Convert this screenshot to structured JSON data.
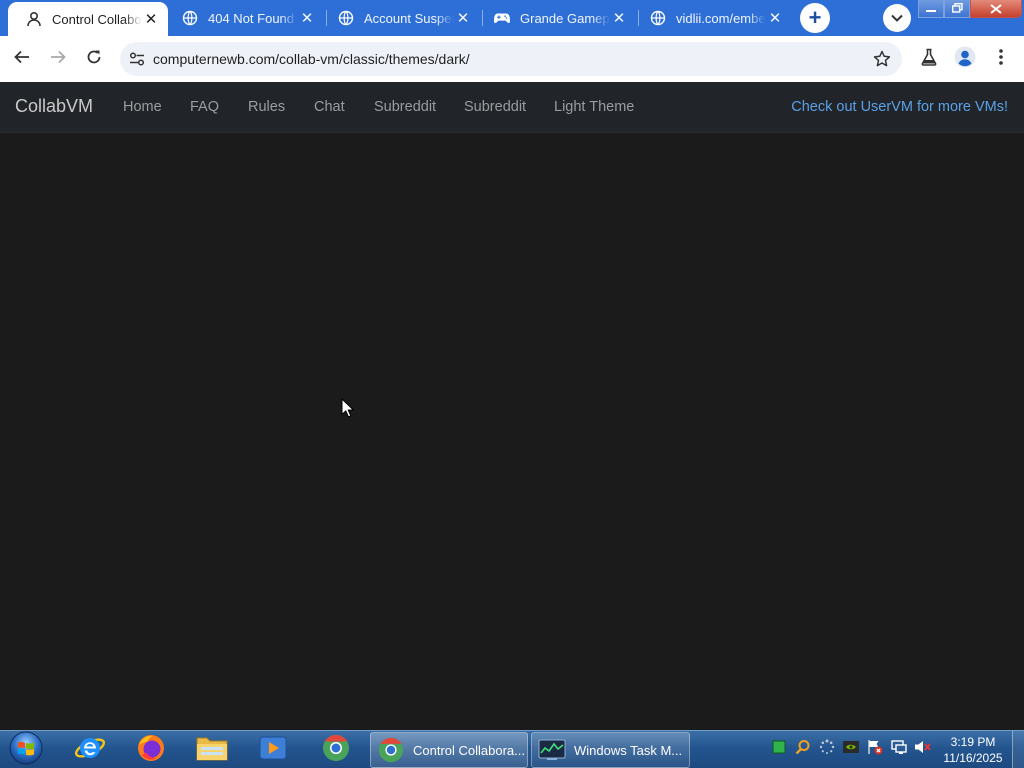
{
  "browser": {
    "tabs": [
      {
        "title": "Control Collaborative Virtual Machines!",
        "active": true,
        "icon": "collabvm-icon"
      },
      {
        "title": "404 Not Found",
        "active": false,
        "icon": "globe-icon"
      },
      {
        "title": "Account Suspended",
        "active": false,
        "icon": "globe-icon"
      },
      {
        "title": "Grande Gameplay",
        "active": false,
        "icon": "gamepad-icon"
      },
      {
        "title": "vidlii.com/embed",
        "active": false,
        "icon": "globe-icon"
      }
    ],
    "close_glyph": "✕",
    "new_tab_glyph": "+",
    "url": "computernewb.com/collab-vm/classic/themes/dark/"
  },
  "page": {
    "brand": "CollabVM",
    "nav_links": [
      "Home",
      "FAQ",
      "Rules",
      "Chat",
      "Subreddit",
      "Subreddit",
      "Light Theme"
    ],
    "promo": "Check out UserVM for more VMs!",
    "colors": {
      "background": "#1b1b1b",
      "navbar": "#212529",
      "link": "#9a9d9f",
      "promo": "#5aa0e6"
    }
  },
  "taskbar": {
    "tasks": [
      {
        "label": "Control Collabora...",
        "icon": "browser-icon"
      },
      {
        "label": "Windows Task M...",
        "icon": "task-manager-icon"
      }
    ],
    "clock": {
      "time": "3:19 PM",
      "date": "11/16/2025"
    }
  }
}
